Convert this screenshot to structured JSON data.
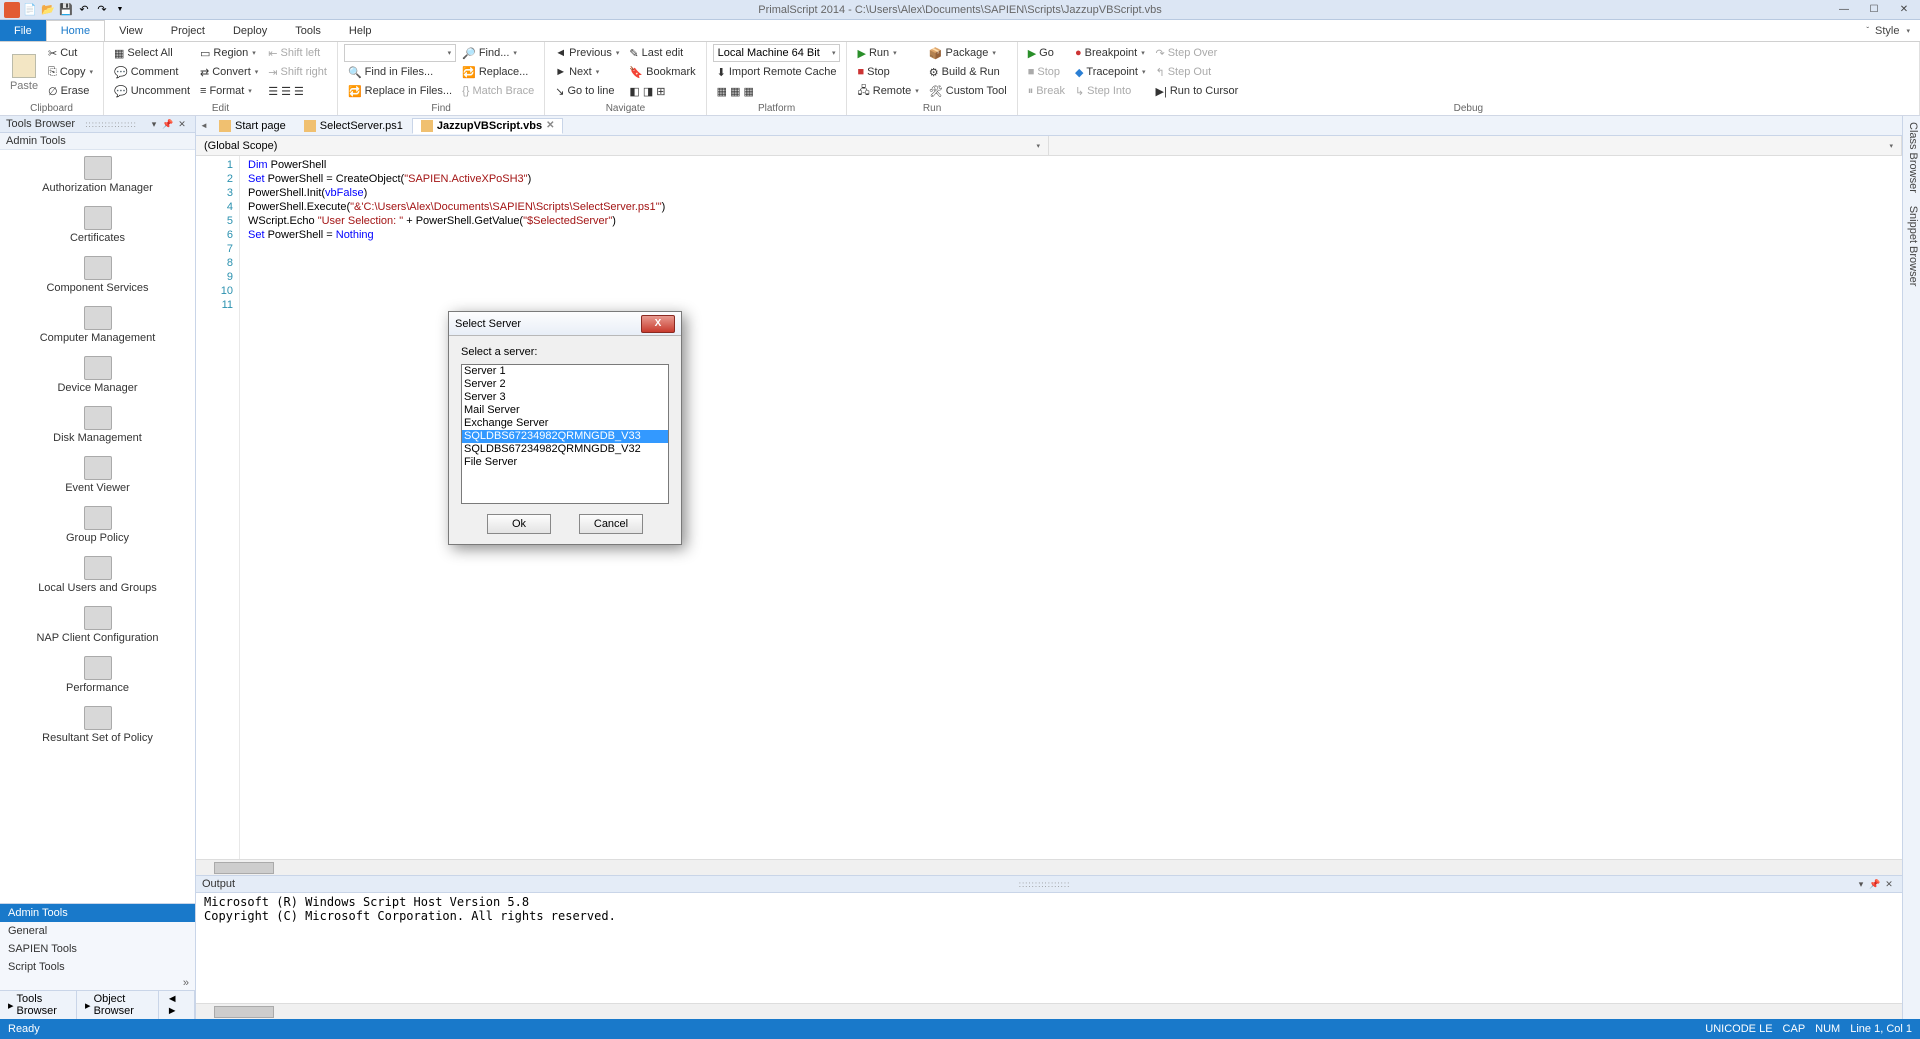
{
  "title": "PrimalScript 2014 - C:\\Users\\Alex\\Documents\\SAPIEN\\Scripts\\JazzupVBScript.vbs",
  "qat_icons": [
    "app-icon",
    "new-icon",
    "open-icon",
    "save-icon",
    "undo-icon",
    "redo-icon"
  ],
  "menubar": {
    "file": "File",
    "tabs": [
      "Home",
      "View",
      "Project",
      "Deploy",
      "Tools",
      "Help"
    ],
    "active": "Home",
    "style": "Style"
  },
  "ribbon": {
    "clipboard": {
      "label": "Clipboard",
      "paste": "Paste",
      "cut": "Cut",
      "copy": "Copy",
      "erase": "Erase"
    },
    "edit": {
      "label": "Edit",
      "selectall": "Select All",
      "comment": "Comment",
      "uncomment": "Uncomment",
      "region": "Region",
      "convert": "Convert",
      "format": "Format",
      "shiftleft": "Shift left",
      "shiftright": "Shift right"
    },
    "find": {
      "label": "Find",
      "find": "Find...",
      "replace": "Replace...",
      "findin": "Find in Files...",
      "replacein": "Replace in Files...",
      "matchbrace": "Match Brace"
    },
    "navigate": {
      "label": "Navigate",
      "previous": "Previous",
      "next": "Next",
      "gotoline": "Go to line",
      "lastedit": "Last edit",
      "bookmark": "Bookmark"
    },
    "platform": {
      "label": "Platform",
      "target": "Local Machine 64 Bit",
      "import": "Import Remote Cache"
    },
    "run": {
      "label": "Run",
      "run": "Run",
      "stop": "Stop",
      "remote": "Remote",
      "package": "Package",
      "buildrun": "Build & Run",
      "custom": "Custom Tool"
    },
    "debug": {
      "label": "Debug",
      "go": "Go",
      "stop": "Stop",
      "break": "Break",
      "breakpoint": "Breakpoint",
      "tracepoint": "Tracepoint",
      "stepinto": "Step Into",
      "stepover": "Step Over",
      "stepout": "Step Out",
      "runtocursor": "Run to Cursor"
    }
  },
  "sidebar": {
    "title": "Tools Browser",
    "subheader": "Admin Tools",
    "tools": [
      "Authorization Manager",
      "Certificates",
      "Component Services",
      "Computer Management",
      "Device Manager",
      "Disk Management",
      "Event Viewer",
      "Group Policy",
      "Local Users and Groups",
      "NAP Client Configuration",
      "Performance",
      "Resultant Set of Policy"
    ],
    "categories": [
      "Admin Tools",
      "General",
      "SAPIEN Tools",
      "Script Tools"
    ],
    "selected_category": "Admin Tools",
    "bottom_tabs": [
      "Tools Browser",
      "Object Browser"
    ]
  },
  "doctabs": [
    {
      "label": "Start page",
      "active": false,
      "icon": "home-icon"
    },
    {
      "label": "SelectServer.ps1",
      "active": false,
      "icon": "ps1-icon"
    },
    {
      "label": "JazzupVBScript.vbs",
      "active": true,
      "icon": "vbs-icon"
    }
  ],
  "scope": "(Global Scope)",
  "code_lines": [
    {
      "n": 1,
      "html": "<span class='kw'>Dim</span> PowerShell"
    },
    {
      "n": 2,
      "html": ""
    },
    {
      "n": 3,
      "html": "<span class='kw'>Set</span> PowerShell = CreateObject(<span class='str'>\"SAPIEN.ActiveXPoSH3\"</span>)"
    },
    {
      "n": 4,
      "html": ""
    },
    {
      "n": 5,
      "html": "PowerShell.Init(<span class='kw'>vbFalse</span>)"
    },
    {
      "n": 6,
      "html": "PowerShell.Execute(<span class='str'>\"&'C:\\Users\\Alex\\Documents\\SAPIEN\\Scripts\\SelectServer.ps1'\"</span>)"
    },
    {
      "n": 7,
      "html": ""
    },
    {
      "n": 8,
      "html": "WScript.Echo <span class='str'>\"User Selection: \"</span> + PowerShell.GetValue(<span class='str'>\"$SelectedServer\"</span>)"
    },
    {
      "n": 9,
      "html": "<span class='kw'>Set</span> PowerShell = <span class='kw'>Nothing</span>"
    },
    {
      "n": 10,
      "html": ""
    },
    {
      "n": 11,
      "html": ""
    }
  ],
  "output": {
    "title": "Output",
    "text": "Microsoft (R) Windows Script Host Version 5.8\nCopyright (C) Microsoft Corporation. All rights reserved.\n"
  },
  "rightrail": [
    "Class Browser",
    "Snippet Browser"
  ],
  "statusbar": {
    "ready": "Ready",
    "encoding": "UNICODE LE",
    "caps": "CAP",
    "num": "NUM",
    "pos": "Line     1, Col   1"
  },
  "dialog": {
    "title": "Select Server",
    "prompt": "Select a server:",
    "items": [
      "Server 1",
      "Server 2",
      "Server 3",
      "Mail Server",
      "Exchange Server",
      "SQLDBS67234982QRMNGDB_V33",
      "SQLDBS67234982QRMNGDB_V32",
      "File Server"
    ],
    "selected": "SQLDBS67234982QRMNGDB_V33",
    "ok": "Ok",
    "cancel": "Cancel"
  }
}
